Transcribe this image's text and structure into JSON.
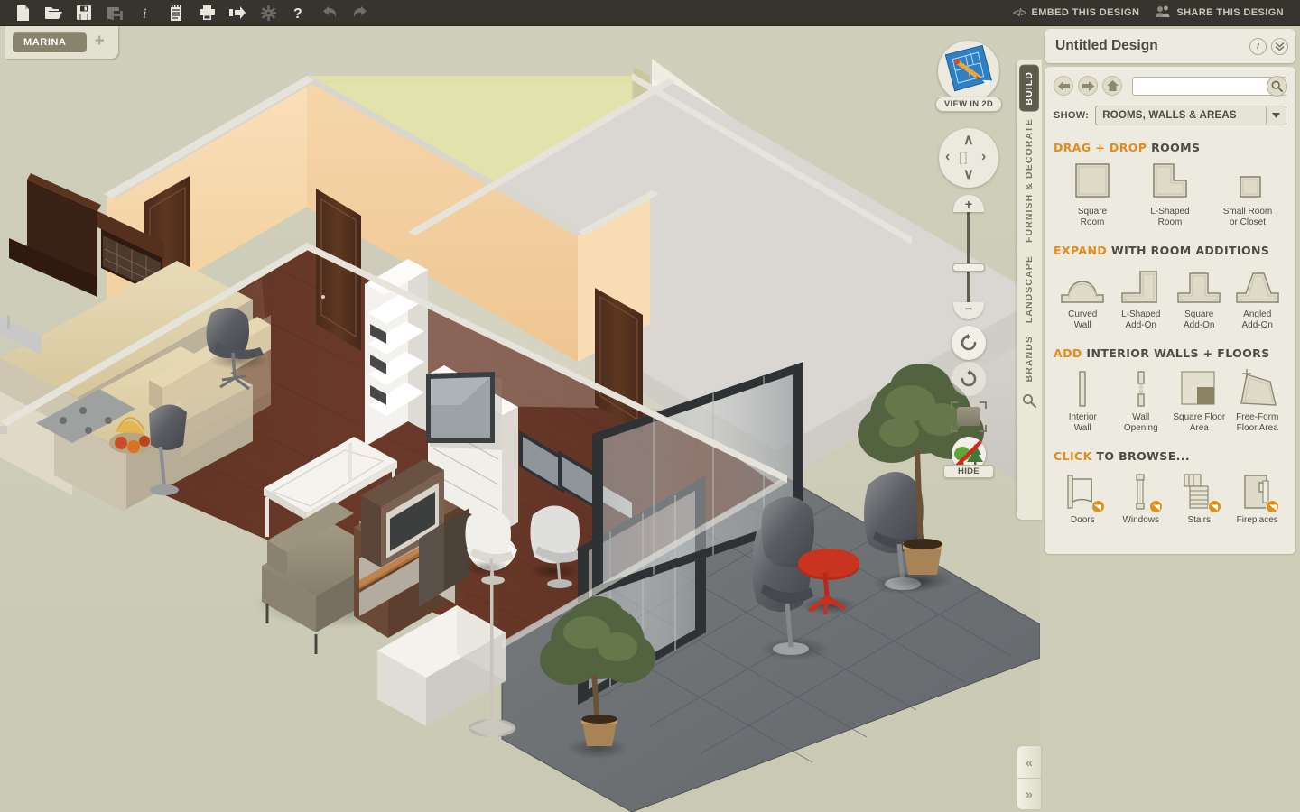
{
  "toolbar": {
    "icons": [
      {
        "name": "new-document-icon",
        "label": "New",
        "dim": false
      },
      {
        "name": "open-folder-icon",
        "label": "Open",
        "dim": false
      },
      {
        "name": "save-icon",
        "label": "Save",
        "dim": false
      },
      {
        "name": "save-as-icon",
        "label": "Save As",
        "dim": true
      },
      {
        "name": "info-icon",
        "label": "Info",
        "dim": false
      },
      {
        "name": "notes-icon",
        "label": "Notes",
        "dim": false
      },
      {
        "name": "print-icon",
        "label": "Print",
        "dim": false
      },
      {
        "name": "export-icon",
        "label": "Export",
        "dim": false
      },
      {
        "name": "settings-gear-icon",
        "label": "Settings",
        "dim": true
      },
      {
        "name": "help-icon",
        "label": "Help",
        "dim": false
      },
      {
        "name": "undo-icon",
        "label": "Undo",
        "dim": true
      },
      {
        "name": "redo-icon",
        "label": "Redo",
        "dim": true
      }
    ],
    "embed_label": "EMBED THIS DESIGN",
    "share_label": "SHARE THIS DESIGN",
    "code_glyph": "</>"
  },
  "tabs": {
    "project_name": "MARINA",
    "add_label": "+"
  },
  "viewport": {
    "view_2d_label": "VIEW IN 2D",
    "hide_label": "HIDE",
    "pan_up": "∧",
    "pan_down": "∨",
    "pan_left": "‹",
    "pan_right": "›",
    "pan_center": "[ ]",
    "zoom_in": "+",
    "zoom_out": "−"
  },
  "sidetabs": [
    {
      "label": "BUILD",
      "active": true
    },
    {
      "label": "FURNISH & DECORATE",
      "active": false
    },
    {
      "label": "LANDSCAPE",
      "active": false
    },
    {
      "label": "BRANDS",
      "active": false
    }
  ],
  "panel": {
    "title": "Untitled Design",
    "info_glyph": "i",
    "collapse_glyph": "⌄",
    "search": {
      "value": "",
      "placeholder": ""
    },
    "show_label": "SHOW:",
    "show_value": "ROOMS, WALLS & AREAS",
    "sections": [
      {
        "title_accent": "DRAG + DROP",
        "title_rest": "ROOMS",
        "items": [
          {
            "icon": "square-room-icon",
            "label": "Square\nRoom",
            "badge": false
          },
          {
            "icon": "l-shaped-room-icon",
            "label": "L-Shaped\nRoom",
            "badge": false
          },
          {
            "icon": "small-room-closet-icon",
            "label": "Small Room\nor Closet",
            "badge": false
          }
        ]
      },
      {
        "title_accent": "EXPAND",
        "title_rest": "WITH ROOM ADDITIONS",
        "items": [
          {
            "icon": "curved-wall-icon",
            "label": "Curved\nWall",
            "badge": false
          },
          {
            "icon": "l-shaped-addon-icon",
            "label": "L-Shaped\nAdd-On",
            "badge": false
          },
          {
            "icon": "square-addon-icon",
            "label": "Square\nAdd-On",
            "badge": false
          },
          {
            "icon": "angled-addon-icon",
            "label": "Angled\nAdd-On",
            "badge": false
          }
        ]
      },
      {
        "title_accent": "ADD",
        "title_rest": "INTERIOR WALLS + FLOORS",
        "items": [
          {
            "icon": "interior-wall-icon",
            "label": "Interior\nWall",
            "badge": false
          },
          {
            "icon": "wall-opening-icon",
            "label": "Wall\nOpening",
            "badge": false
          },
          {
            "icon": "square-floor-area-icon",
            "label": "Square Floor\nArea",
            "badge": false
          },
          {
            "icon": "free-form-floor-area-icon",
            "label": "Free-Form\nFloor Area",
            "badge": false
          }
        ]
      },
      {
        "title_accent": "CLICK",
        "title_rest": "TO BROWSE...",
        "items": [
          {
            "icon": "doors-icon",
            "label": "Doors",
            "badge": true
          },
          {
            "icon": "windows-icon",
            "label": "Windows",
            "badge": true
          },
          {
            "icon": "stairs-icon",
            "label": "Stairs",
            "badge": true
          },
          {
            "icon": "fireplaces-icon",
            "label": "Fireplaces",
            "badge": true
          }
        ]
      }
    ]
  },
  "collapse": {
    "left_glyph": "«",
    "right_glyph": "»"
  },
  "colors": {
    "toolbar_bg": "#36342c",
    "panel_bg": "#edebdf",
    "app_bg": "#cdcdb8",
    "accent_orange": "#e28b1e",
    "active_tab": "#5f5c4d",
    "wall_peach": "#f6d9ae",
    "wall_olive": "#d9d9a4",
    "wall_white": "#f2efe8",
    "floor_wood": "#5e3223",
    "terrace_gray": "#6e7173"
  }
}
